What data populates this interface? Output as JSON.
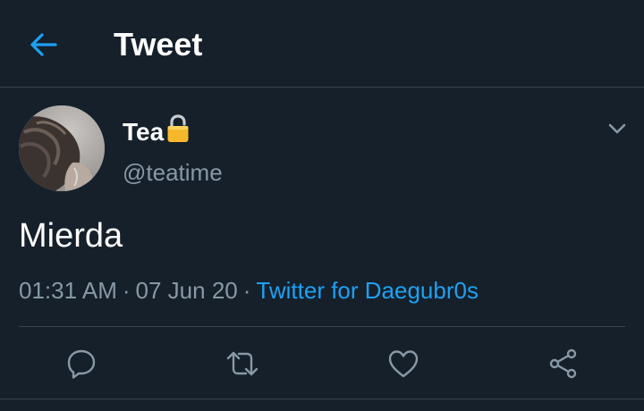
{
  "header": {
    "title": "Tweet",
    "back_icon": "arrow-left-icon",
    "accent_color": "#1da1f2"
  },
  "tweet": {
    "author": {
      "display_name": "Tea",
      "lock_icon": "lock-icon",
      "handle": "@teatime"
    },
    "text": "Mierda",
    "time": "01:31 AM",
    "date": "07 Jun 20",
    "separator": "·",
    "source": "Twitter for Daegubr0s"
  },
  "actions": [
    {
      "name": "reply",
      "icon": "reply-icon"
    },
    {
      "name": "retweet",
      "icon": "retweet-icon"
    },
    {
      "name": "like",
      "icon": "heart-icon"
    },
    {
      "name": "share",
      "icon": "share-icon"
    }
  ],
  "colors": {
    "background": "#15202b",
    "divider": "#38444d",
    "secondary_text": "#8899a6",
    "link": "#1da1f2"
  }
}
